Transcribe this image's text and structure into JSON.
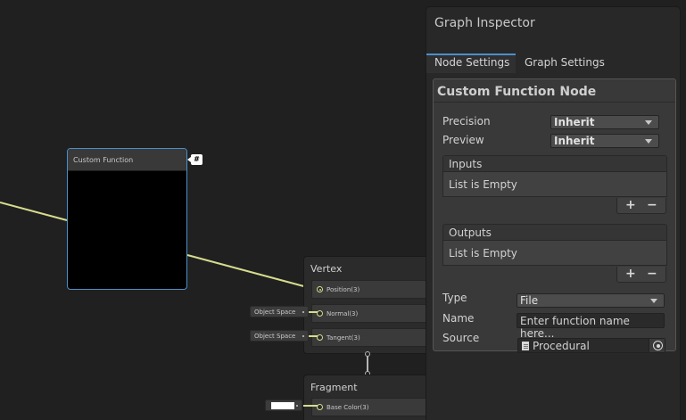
{
  "graph": {
    "custom_function_node": {
      "title": "Custom Function",
      "badge": "#"
    },
    "vertex": {
      "title": "Vertex",
      "ports": [
        {
          "label": "Position(3)"
        },
        {
          "label": "Normal(3)",
          "space": "Object Space"
        },
        {
          "label": "Tangent(3)",
          "space": "Object Space"
        }
      ]
    },
    "fragment": {
      "title": "Fragment",
      "ports": [
        {
          "label": "Base Color(3)",
          "color": "#ffffff"
        }
      ]
    },
    "wire_color": "#d7dc8e",
    "selection_color": "#4b8fc9"
  },
  "inspector": {
    "title": "Graph Inspector",
    "tabs": [
      {
        "label": "Node Settings"
      },
      {
        "label": "Graph Settings"
      }
    ],
    "panel": {
      "title": "Custom Function Node",
      "precision": {
        "label": "Precision",
        "value": "Inherit"
      },
      "preview": {
        "label": "Preview",
        "value": "Inherit"
      },
      "inputs": {
        "label": "Inputs",
        "empty_text": "List is Empty",
        "add": "+",
        "remove": "−"
      },
      "outputs": {
        "label": "Outputs",
        "empty_text": "List is Empty",
        "add": "+",
        "remove": "−"
      },
      "type": {
        "label": "Type",
        "value": "File"
      },
      "name": {
        "label": "Name",
        "placeholder": "Enter function name here..."
      },
      "source": {
        "label": "Source",
        "value": "Procedural"
      }
    }
  }
}
